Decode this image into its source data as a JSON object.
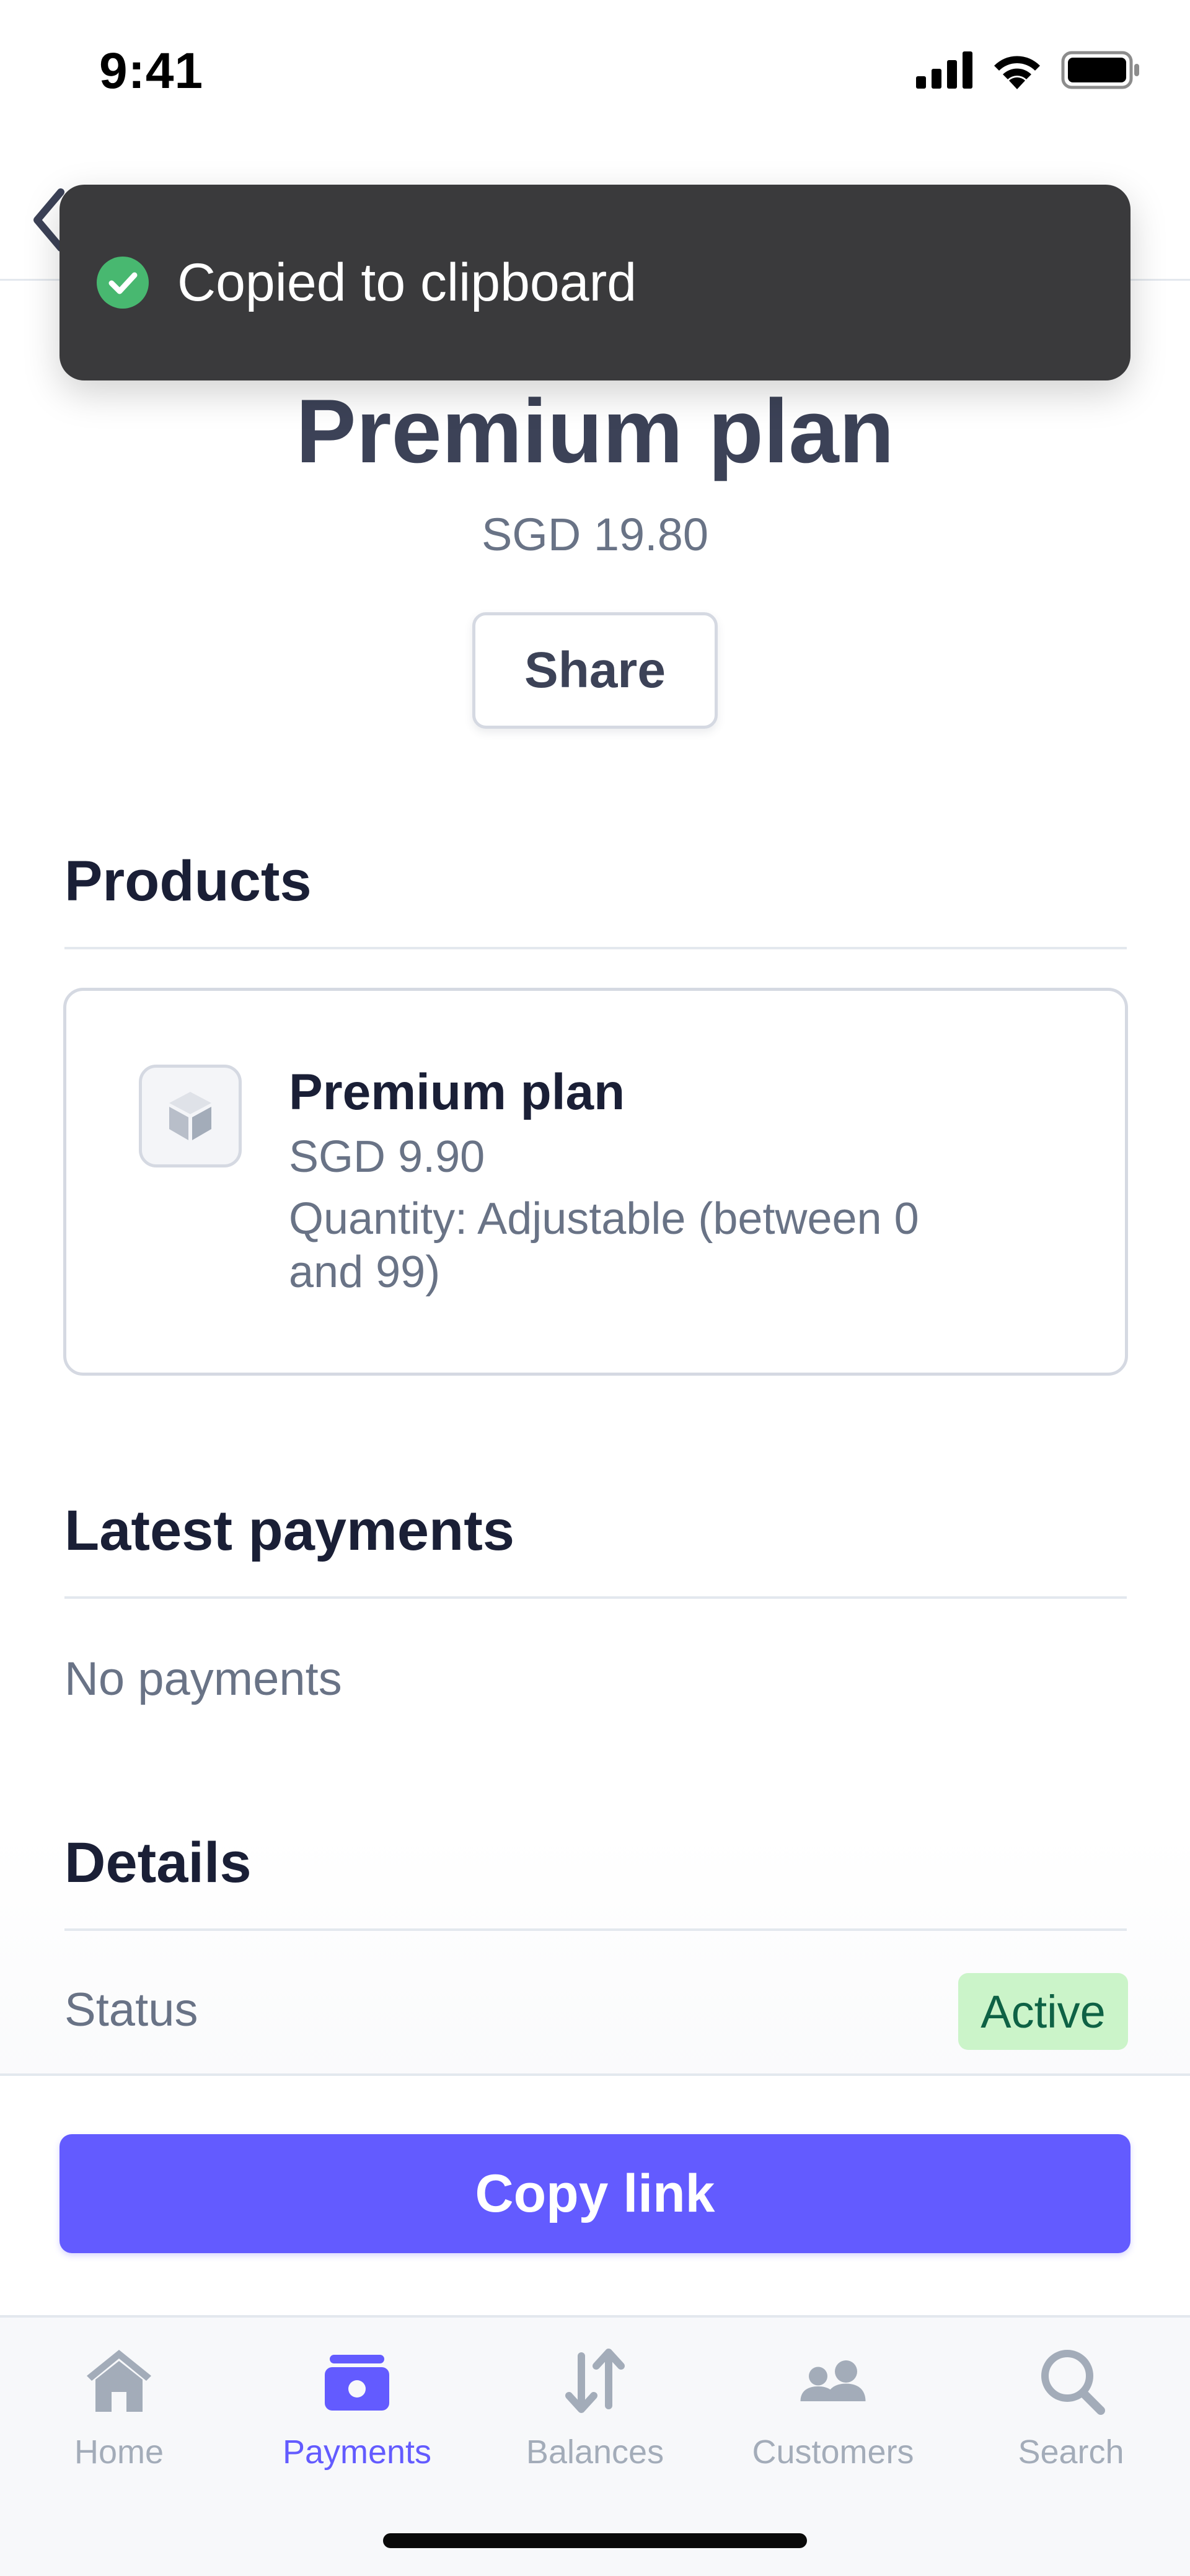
{
  "status_bar": {
    "time": "9:41"
  },
  "toast": {
    "message": "Copied to clipboard"
  },
  "plan": {
    "title": "Premium plan",
    "price": "SGD 19.80",
    "share_label": "Share"
  },
  "products": {
    "heading": "Products",
    "items": [
      {
        "name": "Premium plan",
        "price": "SGD 9.90",
        "quantity": "Quantity: Adjustable (between 0 and 99)"
      }
    ]
  },
  "latest_payments": {
    "heading": "Latest payments",
    "empty_text": "No payments"
  },
  "details": {
    "heading": "Details",
    "status_label": "Status",
    "status_value": "Active"
  },
  "actions": {
    "copy_link_label": "Copy link"
  },
  "tabbar": {
    "items": [
      {
        "label": "Home",
        "icon": "home-icon",
        "active": false
      },
      {
        "label": "Payments",
        "icon": "payments-icon",
        "active": true
      },
      {
        "label": "Balances",
        "icon": "balances-icon",
        "active": false
      },
      {
        "label": "Customers",
        "icon": "customers-icon",
        "active": false
      },
      {
        "label": "Search",
        "icon": "search-icon",
        "active": false
      }
    ]
  },
  "colors": {
    "accent": "#635bff",
    "toast_bg": "#3a3a3c",
    "success": "#48b870",
    "badge_bg": "#cbf4c9",
    "badge_text": "#0e6245"
  }
}
